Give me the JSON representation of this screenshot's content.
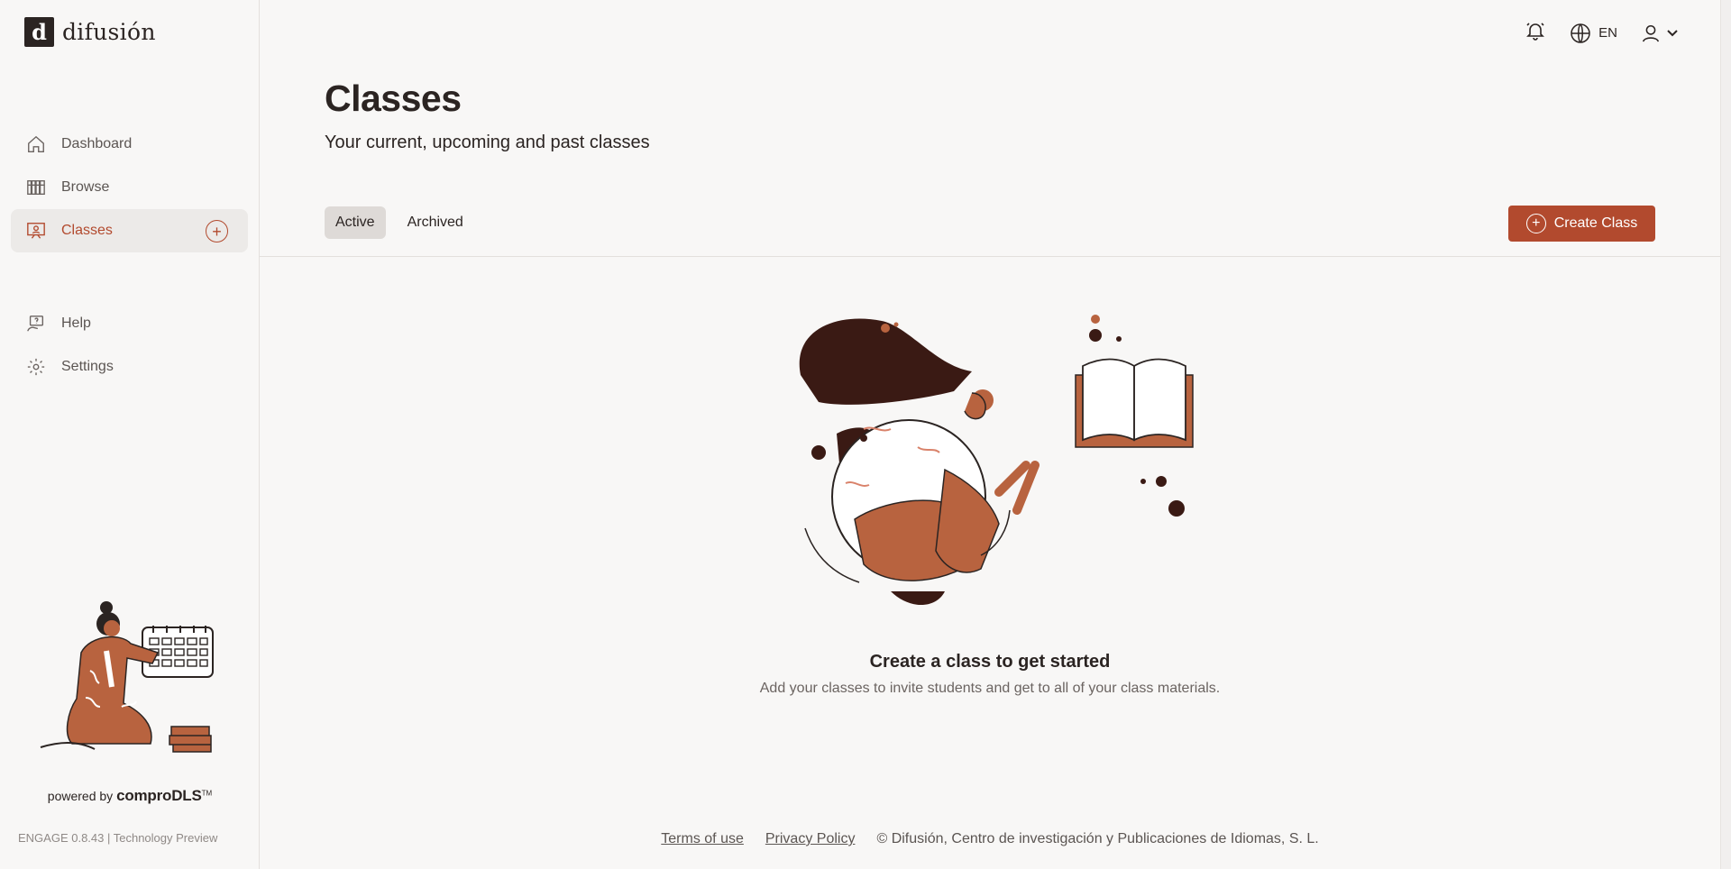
{
  "brand": {
    "logo_mark": "d",
    "name": "difusión"
  },
  "sidebar": {
    "items": [
      {
        "label": "Dashboard",
        "icon": "home-icon"
      },
      {
        "label": "Browse",
        "icon": "books-icon"
      },
      {
        "label": "Classes",
        "icon": "classroom-icon",
        "active": true
      },
      {
        "label": "Help",
        "icon": "help-icon"
      },
      {
        "label": "Settings",
        "icon": "gear-icon"
      }
    ],
    "powered_prefix": "powered by",
    "powered_brand": "comproDLS",
    "powered_tm": "TM",
    "version": "ENGAGE 0.8.43 | Technology Preview"
  },
  "header": {
    "language": "EN"
  },
  "page": {
    "title": "Classes",
    "subtitle": "Your current, upcoming and past classes",
    "tabs": [
      {
        "label": "Active",
        "active": true
      },
      {
        "label": "Archived"
      }
    ],
    "create_label": "Create Class"
  },
  "empty_state": {
    "title": "Create a class to get started",
    "description": "Add your classes to invite students and get to all of your class materials."
  },
  "footer": {
    "terms": "Terms of use",
    "privacy": "Privacy Policy",
    "copyright": "© Difusión, Centro de investigación y Publicaciones de Idiomas, S. L."
  },
  "colors": {
    "accent": "#b24a2e",
    "text": "#2b2422",
    "background": "#f8f7f6"
  }
}
